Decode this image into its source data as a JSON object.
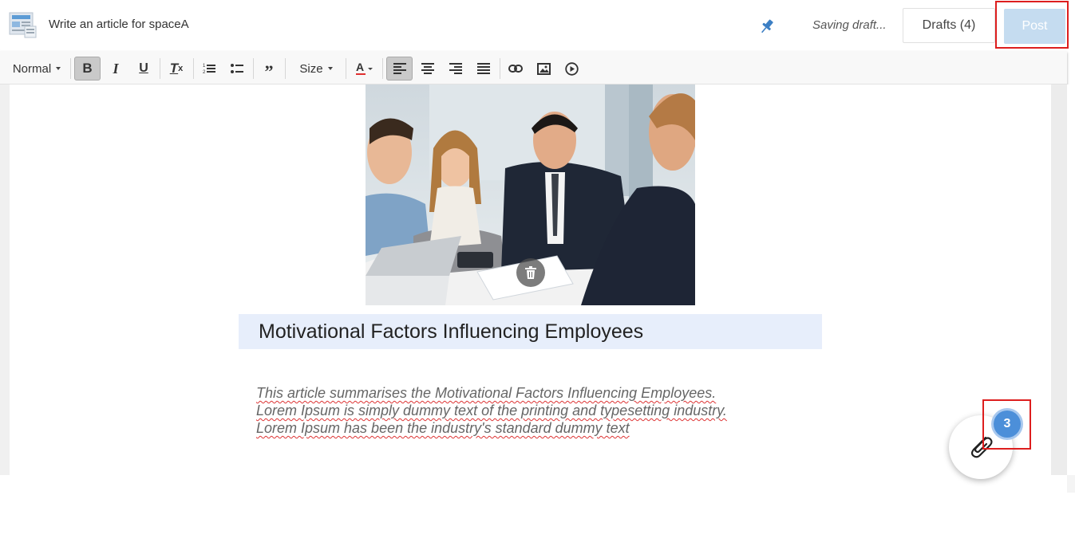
{
  "header": {
    "title": "Write an article for spaceA",
    "status": "Saving draft...",
    "drafts_label": "Drafts (4)",
    "post_label": "Post"
  },
  "toolbar": {
    "paragraph_style": "Normal",
    "size_label": "Size",
    "buttons": [
      "bold-icon",
      "italic-icon",
      "underline-icon",
      "clear-format-icon",
      "ordered-list-icon",
      "bullet-list-icon",
      "quote-icon",
      "text-color-icon",
      "align-left-icon",
      "align-center-icon",
      "align-right-icon",
      "align-justify-icon",
      "link-icon",
      "image-icon",
      "video-icon"
    ],
    "active": [
      "bold",
      "align-left"
    ]
  },
  "article": {
    "title": "Motivational Factors Influencing Employees",
    "body_lines": [
      "This article summarises the Motivational Factors Influencing Employees.",
      "Lorem Ipsum is simply dummy text of the printing and typesetting industry.",
      "Lorem Ipsum has been the industry's standard dummy text"
    ]
  },
  "attachments": {
    "count": "3"
  },
  "colors": {
    "accent": "#4c8fd9",
    "post_disabled": "#c5dcf0",
    "highlight_box": "#dd1e1e",
    "title_bg": "#e7eefb"
  }
}
